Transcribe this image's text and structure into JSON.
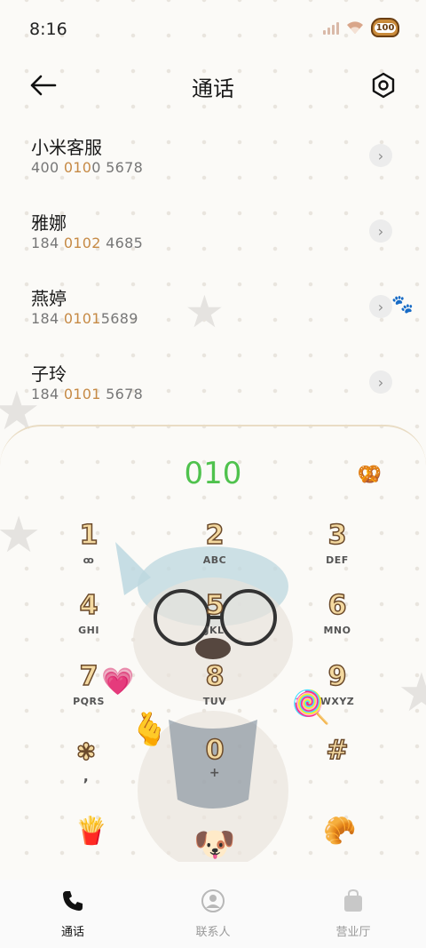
{
  "status": {
    "time": "8:16",
    "battery": "100"
  },
  "header": {
    "title": "通话"
  },
  "contacts": [
    {
      "name": "小米客服",
      "num_pre": "400 ",
      "num_hl": "010",
      "num_post": "0 5678"
    },
    {
      "name": "雅娜",
      "num_pre": "184 ",
      "num_hl": "0102",
      "num_post": " 4685"
    },
    {
      "name": "燕婷",
      "num_pre": "184 ",
      "num_hl": "0101",
      "num_post": "5689"
    },
    {
      "name": "子玲",
      "num_pre": "184 ",
      "num_hl": "0101",
      "num_post": " 5678"
    }
  ],
  "dialer": {
    "input": "010",
    "keys": [
      {
        "digit": "1",
        "letters": "ꝏ"
      },
      {
        "digit": "2",
        "letters": "ABC"
      },
      {
        "digit": "3",
        "letters": "DEF"
      },
      {
        "digit": "4",
        "letters": "GHI"
      },
      {
        "digit": "5",
        "letters": "JKL"
      },
      {
        "digit": "6",
        "letters": "MNO"
      },
      {
        "digit": "7",
        "letters": "PQRS"
      },
      {
        "digit": "8",
        "letters": "TUV"
      },
      {
        "digit": "9",
        "letters": "WXYZ"
      },
      {
        "digit": "✽",
        "letters": ","
      },
      {
        "digit": "0",
        "letters": "+"
      },
      {
        "digit": "#",
        "letters": ""
      }
    ]
  },
  "tabs": [
    {
      "label": "通话",
      "active": true
    },
    {
      "label": "联系人",
      "active": false
    },
    {
      "label": "营业厅",
      "active": false
    }
  ],
  "colors": {
    "accent_orange": "#c68a45",
    "dialed_green": "#4fc24d"
  }
}
